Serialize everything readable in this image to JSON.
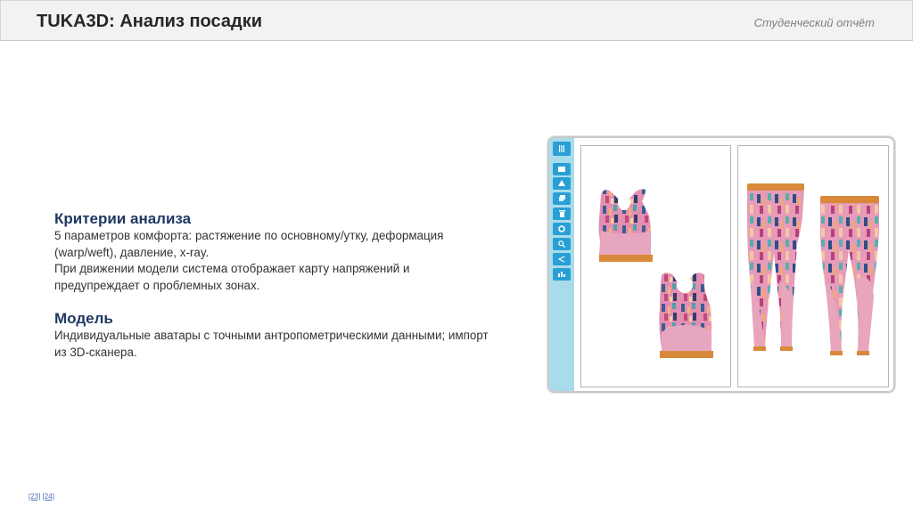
{
  "header": {
    "title": "TUKA3D: Анализ посадки",
    "subtitle": "Студенческий отчёт"
  },
  "sections": [
    {
      "heading": "Критерии анализа",
      "lines": [
        "5 параметров комфорта: растяжение по основному/утку, деформация",
        "(warp/weft), давление, x-ray.",
        "При движении модели система отображает карту напряжений и",
        "предупреждает о проблемных зонах."
      ]
    },
    {
      "heading": "Модель",
      "lines": [
        "Индивидуальные аватары с точными антропометрическими данными; импорт",
        "из 3D-сканера."
      ]
    }
  ],
  "app": {
    "toolbar_icons": [
      "menu-icon",
      "mail-icon",
      "triangle-icon",
      "layers-icon",
      "trash-icon",
      "gear-icon",
      "search-icon",
      "share-icon",
      "chart-icon"
    ],
    "colors": {
      "toolbar_bg": "#a9dcea",
      "tool_button": "#2a9fd6",
      "garment_pink": "#e8a5bb",
      "garment_trim": "#d9893a"
    }
  },
  "footer": {
    "refs": [
      "[23]",
      "[24]"
    ]
  }
}
